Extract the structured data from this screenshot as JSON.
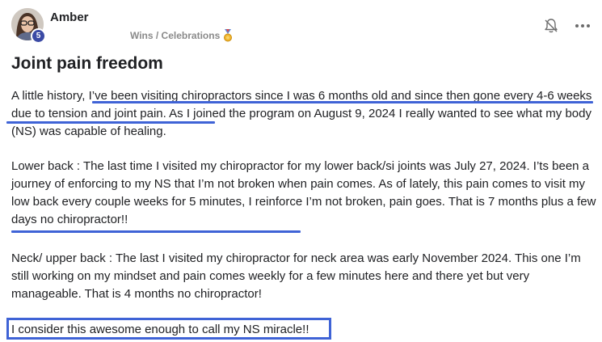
{
  "post": {
    "author": "Amber",
    "level": "5",
    "category": "Wins / Celebrations",
    "title": "Joint pain freedom",
    "paragraphs": {
      "p1_a": "A little history, ",
      "p1_b": "I’ve been visiting chiropractors since I was 6 months old and since then gone every 4-6 weeks due to tension and joint pain",
      "p1_c": ". As I joined the program on August 9, 2024 I really wanted to see what my body (NS) was capable of healing.",
      "p2_a": "Lower back : The last time I visited my chiropractor for my lower back/si joints was July 27, 2024. I’ts been a journey of enforcing to my NS that I’m not broken when pain comes. As of lately, this pain comes to visit my low back every couple weeks for 5 minutes, I reinforce I’m not broken, pain goes. ",
      "p2_b": "That is 7 months plus a few days no chiropractor!!",
      "p3": "Neck/ upper back : The last I visited my chiropractor for neck area was early November 2024. This one I’m still working on my mindset and pain comes weekly for a few minutes here and there yet but very manageable. That is 4 months no chiropractor!",
      "p4": "I consider this awesome enough to call my NS miracle!!"
    }
  },
  "icons": {
    "category_icon": "medal-icon",
    "notification_icon": "bell-off-icon",
    "menu_icon": "more-horizontal-icon"
  },
  "colors": {
    "annotation": "#3f63d6",
    "badge": "#3b4aa5",
    "muted_text": "#8a8a8a"
  }
}
